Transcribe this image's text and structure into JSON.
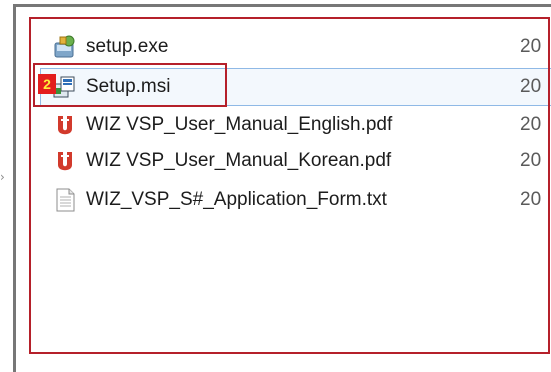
{
  "files": [
    {
      "name": "setup.exe",
      "date": "20",
      "icon": "setup-exe-icon"
    },
    {
      "name": "Setup.msi",
      "date": "20",
      "icon": "msi-installer-icon"
    },
    {
      "name": "WIZ VSP_User_Manual_English.pdf",
      "date": "20",
      "icon": "pdf-icon"
    },
    {
      "name": "WIZ VSP_User_Manual_Korean.pdf",
      "date": "20",
      "icon": "pdf-icon"
    },
    {
      "name": "WIZ_VSP_S#_Application_Form.txt",
      "date": "20",
      "icon": "text-file-icon"
    }
  ],
  "annotation": {
    "step_number": "2"
  },
  "colors": {
    "highlight_red": "#b5202a",
    "badge_red": "#e31d1d",
    "badge_text": "#ffef3a",
    "selection_blue": "#8fb9e6"
  }
}
